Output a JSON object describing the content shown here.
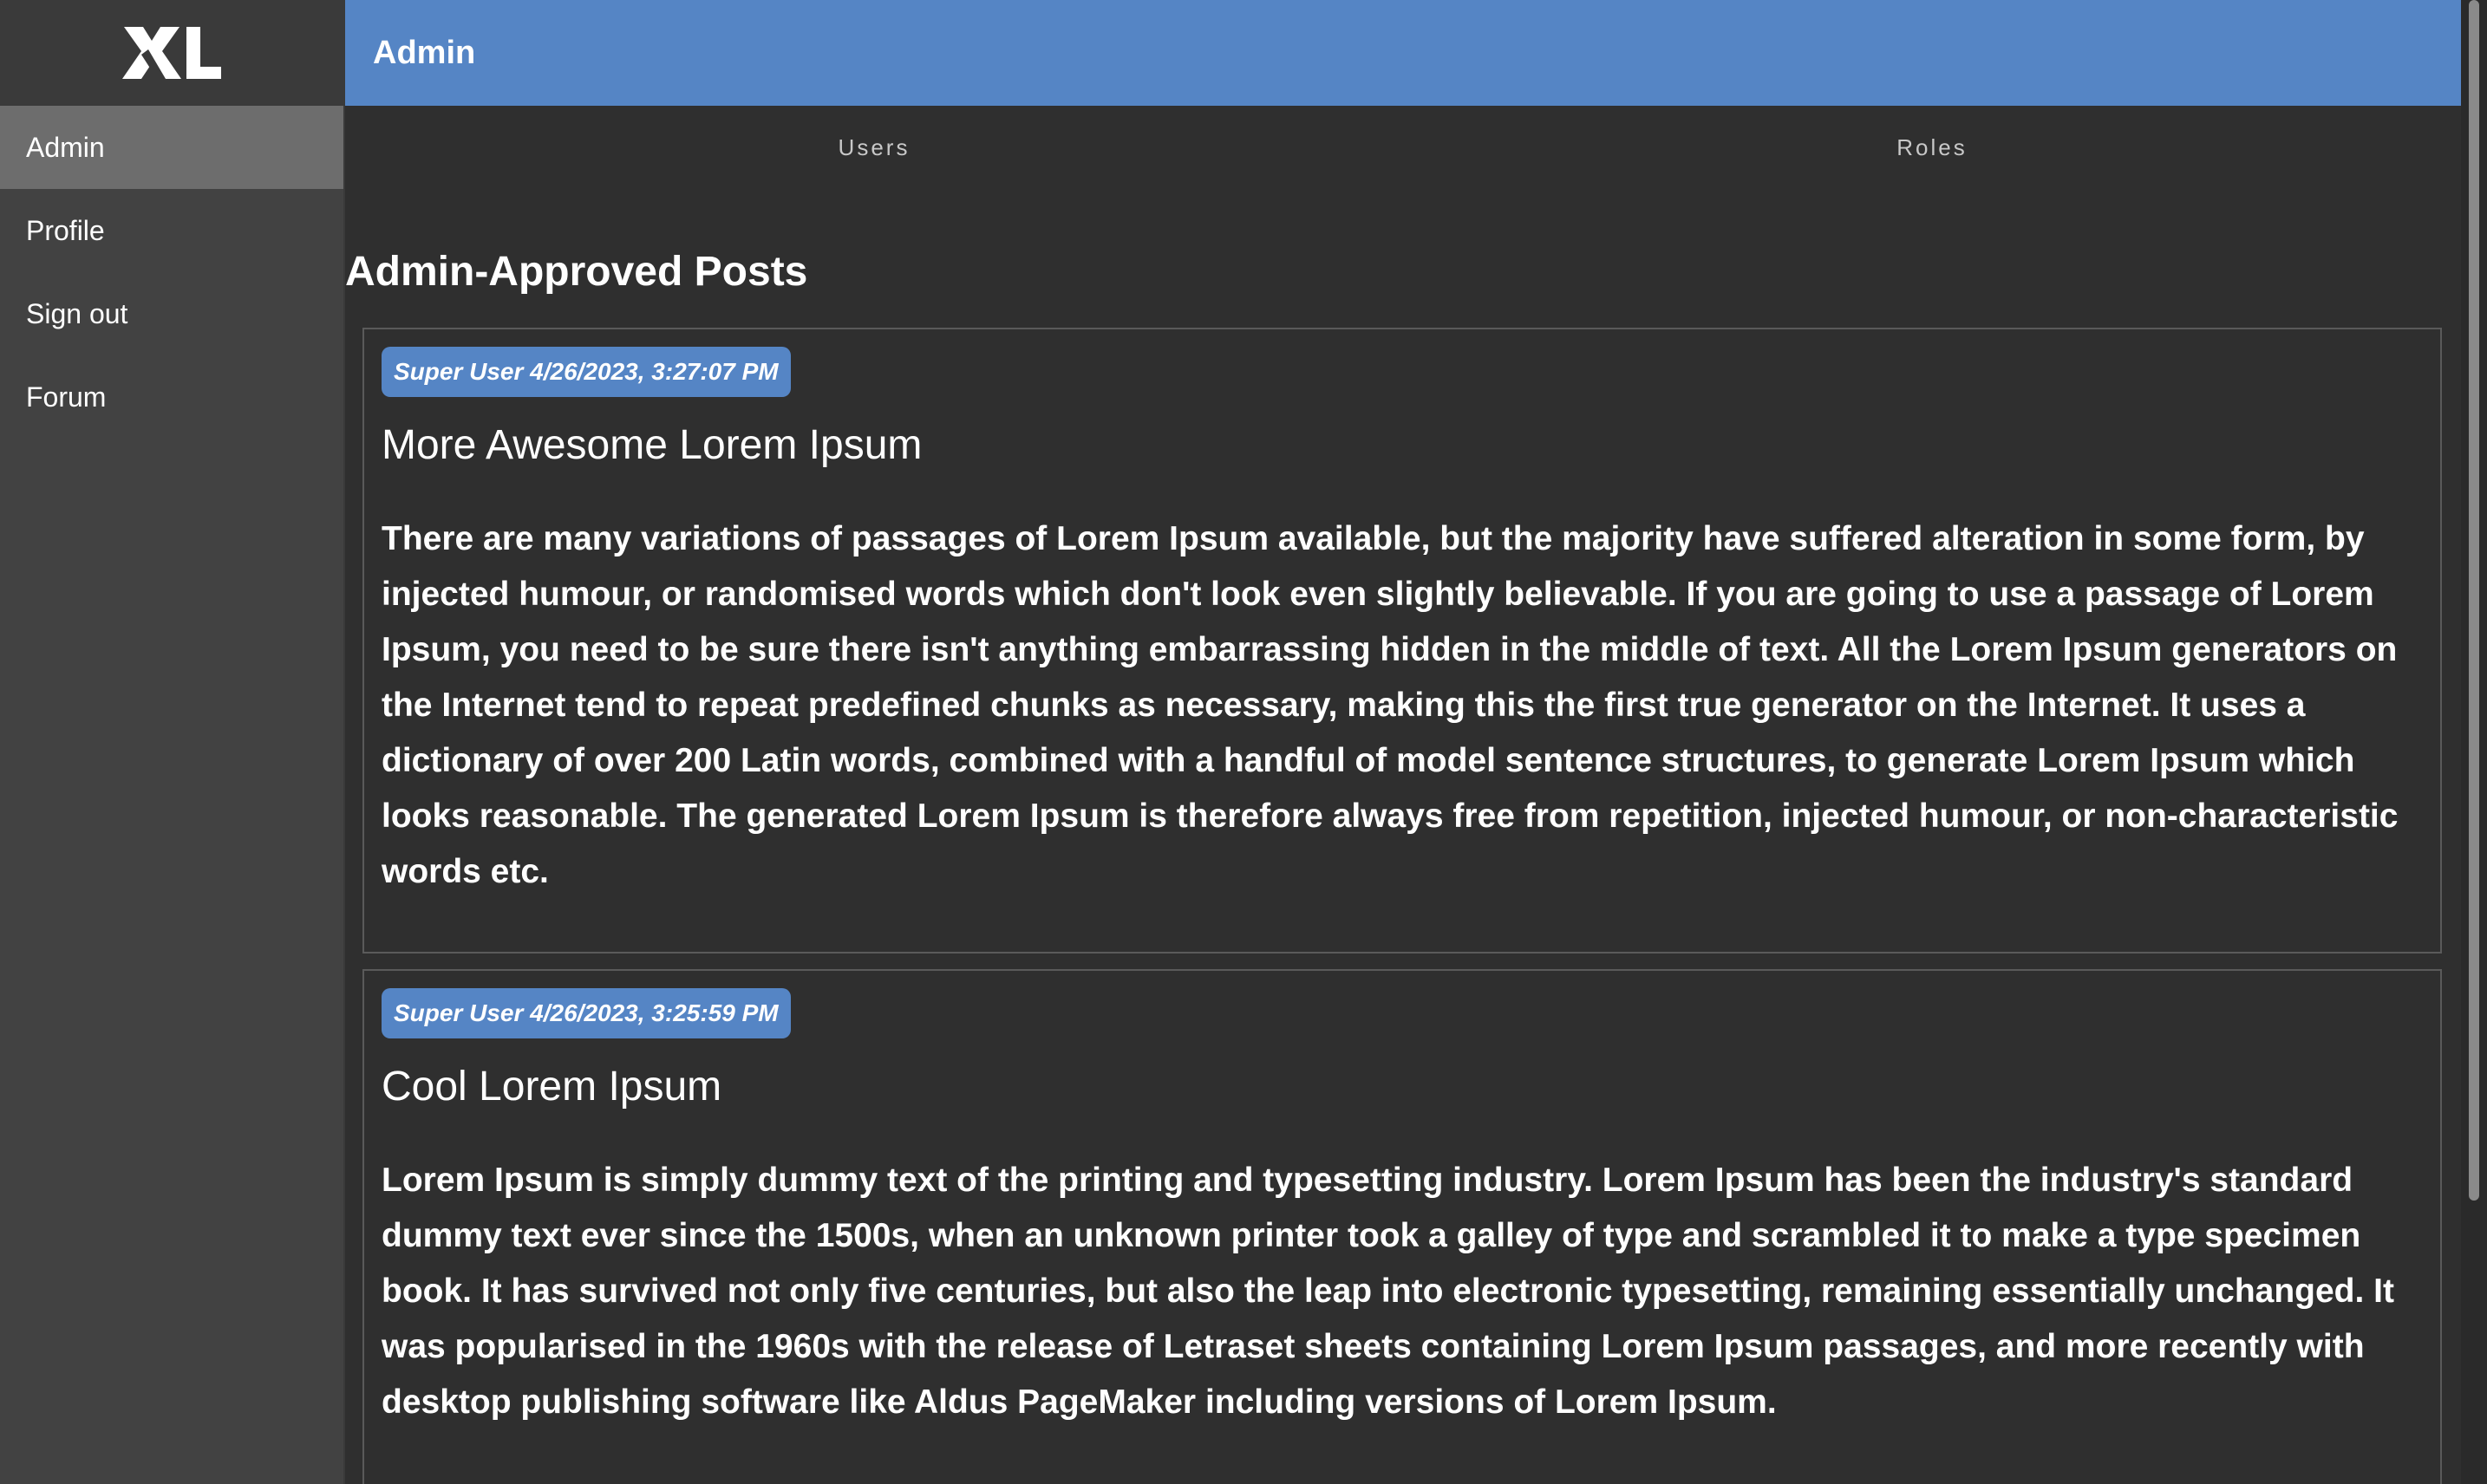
{
  "app": {
    "logo_text": "XL"
  },
  "sidebar": {
    "items": [
      {
        "label": "Admin",
        "active": true
      },
      {
        "label": "Profile",
        "active": false
      },
      {
        "label": "Sign out",
        "active": false
      },
      {
        "label": "Forum",
        "active": false
      }
    ]
  },
  "header": {
    "title": "Admin"
  },
  "tabs": [
    {
      "label": "Users"
    },
    {
      "label": "Roles"
    }
  ],
  "section": {
    "title": "Admin-Approved Posts"
  },
  "posts": [
    {
      "author_timestamp": "Super User 4/26/2023, 3:27:07 PM",
      "title": "More Awesome Lorem Ipsum",
      "body": "There are many variations of passages of Lorem Ipsum available, but the majority have suffered alteration in some form, by injected humour, or randomised words which don't look even slightly believable. If you are going to use a passage of Lorem Ipsum, you need to be sure there isn't anything embarrassing hidden in the middle of text. All the Lorem Ipsum generators on the Internet tend to repeat predefined chunks as necessary, making this the first true generator on the Internet. It uses a dictionary of over 200 Latin words, combined with a handful of model sentence structures, to generate Lorem Ipsum which looks reasonable. The generated Lorem Ipsum is therefore always free from repetition, injected humour, or non-characteristic words etc."
    },
    {
      "author_timestamp": "Super User 4/26/2023, 3:25:59 PM",
      "title": "Cool Lorem Ipsum",
      "body": "Lorem Ipsum is simply dummy text of the printing and typesetting industry. Lorem Ipsum has been the industry's standard dummy text ever since the 1500s, when an unknown printer took a galley of type and scrambled it to make a type specimen book. It has survived not only five centuries, but also the leap into electronic typesetting, remaining essentially unchanged. It was popularised in the 1960s with the release of Letraset sheets containing Lorem Ipsum passages, and more recently with desktop publishing software like Aldus PageMaker including versions of Lorem Ipsum."
    }
  ],
  "colors": {
    "accent": "#5585c5",
    "sidebar_bg": "#424242",
    "sidebar_active": "#6d6d6d",
    "main_bg": "#2f2f2f"
  }
}
